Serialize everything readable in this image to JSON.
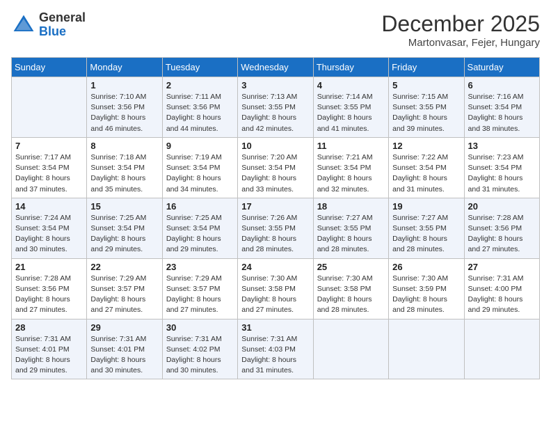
{
  "header": {
    "logo_line1": "General",
    "logo_line2": "Blue",
    "month": "December 2025",
    "location": "Martonvasar, Fejer, Hungary"
  },
  "weekdays": [
    "Sunday",
    "Monday",
    "Tuesday",
    "Wednesday",
    "Thursday",
    "Friday",
    "Saturday"
  ],
  "weeks": [
    [
      {
        "day": "",
        "sunrise": "",
        "sunset": "",
        "daylight": ""
      },
      {
        "day": "1",
        "sunrise": "Sunrise: 7:10 AM",
        "sunset": "Sunset: 3:56 PM",
        "daylight": "Daylight: 8 hours and 46 minutes."
      },
      {
        "day": "2",
        "sunrise": "Sunrise: 7:11 AM",
        "sunset": "Sunset: 3:56 PM",
        "daylight": "Daylight: 8 hours and 44 minutes."
      },
      {
        "day": "3",
        "sunrise": "Sunrise: 7:13 AM",
        "sunset": "Sunset: 3:55 PM",
        "daylight": "Daylight: 8 hours and 42 minutes."
      },
      {
        "day": "4",
        "sunrise": "Sunrise: 7:14 AM",
        "sunset": "Sunset: 3:55 PM",
        "daylight": "Daylight: 8 hours and 41 minutes."
      },
      {
        "day": "5",
        "sunrise": "Sunrise: 7:15 AM",
        "sunset": "Sunset: 3:55 PM",
        "daylight": "Daylight: 8 hours and 39 minutes."
      },
      {
        "day": "6",
        "sunrise": "Sunrise: 7:16 AM",
        "sunset": "Sunset: 3:54 PM",
        "daylight": "Daylight: 8 hours and 38 minutes."
      }
    ],
    [
      {
        "day": "7",
        "sunrise": "Sunrise: 7:17 AM",
        "sunset": "Sunset: 3:54 PM",
        "daylight": "Daylight: 8 hours and 37 minutes."
      },
      {
        "day": "8",
        "sunrise": "Sunrise: 7:18 AM",
        "sunset": "Sunset: 3:54 PM",
        "daylight": "Daylight: 8 hours and 35 minutes."
      },
      {
        "day": "9",
        "sunrise": "Sunrise: 7:19 AM",
        "sunset": "Sunset: 3:54 PM",
        "daylight": "Daylight: 8 hours and 34 minutes."
      },
      {
        "day": "10",
        "sunrise": "Sunrise: 7:20 AM",
        "sunset": "Sunset: 3:54 PM",
        "daylight": "Daylight: 8 hours and 33 minutes."
      },
      {
        "day": "11",
        "sunrise": "Sunrise: 7:21 AM",
        "sunset": "Sunset: 3:54 PM",
        "daylight": "Daylight: 8 hours and 32 minutes."
      },
      {
        "day": "12",
        "sunrise": "Sunrise: 7:22 AM",
        "sunset": "Sunset: 3:54 PM",
        "daylight": "Daylight: 8 hours and 31 minutes."
      },
      {
        "day": "13",
        "sunrise": "Sunrise: 7:23 AM",
        "sunset": "Sunset: 3:54 PM",
        "daylight": "Daylight: 8 hours and 31 minutes."
      }
    ],
    [
      {
        "day": "14",
        "sunrise": "Sunrise: 7:24 AM",
        "sunset": "Sunset: 3:54 PM",
        "daylight": "Daylight: 8 hours and 30 minutes."
      },
      {
        "day": "15",
        "sunrise": "Sunrise: 7:25 AM",
        "sunset": "Sunset: 3:54 PM",
        "daylight": "Daylight: 8 hours and 29 minutes."
      },
      {
        "day": "16",
        "sunrise": "Sunrise: 7:25 AM",
        "sunset": "Sunset: 3:54 PM",
        "daylight": "Daylight: 8 hours and 29 minutes."
      },
      {
        "day": "17",
        "sunrise": "Sunrise: 7:26 AM",
        "sunset": "Sunset: 3:55 PM",
        "daylight": "Daylight: 8 hours and 28 minutes."
      },
      {
        "day": "18",
        "sunrise": "Sunrise: 7:27 AM",
        "sunset": "Sunset: 3:55 PM",
        "daylight": "Daylight: 8 hours and 28 minutes."
      },
      {
        "day": "19",
        "sunrise": "Sunrise: 7:27 AM",
        "sunset": "Sunset: 3:55 PM",
        "daylight": "Daylight: 8 hours and 28 minutes."
      },
      {
        "day": "20",
        "sunrise": "Sunrise: 7:28 AM",
        "sunset": "Sunset: 3:56 PM",
        "daylight": "Daylight: 8 hours and 27 minutes."
      }
    ],
    [
      {
        "day": "21",
        "sunrise": "Sunrise: 7:28 AM",
        "sunset": "Sunset: 3:56 PM",
        "daylight": "Daylight: 8 hours and 27 minutes."
      },
      {
        "day": "22",
        "sunrise": "Sunrise: 7:29 AM",
        "sunset": "Sunset: 3:57 PM",
        "daylight": "Daylight: 8 hours and 27 minutes."
      },
      {
        "day": "23",
        "sunrise": "Sunrise: 7:29 AM",
        "sunset": "Sunset: 3:57 PM",
        "daylight": "Daylight: 8 hours and 27 minutes."
      },
      {
        "day": "24",
        "sunrise": "Sunrise: 7:30 AM",
        "sunset": "Sunset: 3:58 PM",
        "daylight": "Daylight: 8 hours and 27 minutes."
      },
      {
        "day": "25",
        "sunrise": "Sunrise: 7:30 AM",
        "sunset": "Sunset: 3:58 PM",
        "daylight": "Daylight: 8 hours and 28 minutes."
      },
      {
        "day": "26",
        "sunrise": "Sunrise: 7:30 AM",
        "sunset": "Sunset: 3:59 PM",
        "daylight": "Daylight: 8 hours and 28 minutes."
      },
      {
        "day": "27",
        "sunrise": "Sunrise: 7:31 AM",
        "sunset": "Sunset: 4:00 PM",
        "daylight": "Daylight: 8 hours and 29 minutes."
      }
    ],
    [
      {
        "day": "28",
        "sunrise": "Sunrise: 7:31 AM",
        "sunset": "Sunset: 4:01 PM",
        "daylight": "Daylight: 8 hours and 29 minutes."
      },
      {
        "day": "29",
        "sunrise": "Sunrise: 7:31 AM",
        "sunset": "Sunset: 4:01 PM",
        "daylight": "Daylight: 8 hours and 30 minutes."
      },
      {
        "day": "30",
        "sunrise": "Sunrise: 7:31 AM",
        "sunset": "Sunset: 4:02 PM",
        "daylight": "Daylight: 8 hours and 30 minutes."
      },
      {
        "day": "31",
        "sunrise": "Sunrise: 7:31 AM",
        "sunset": "Sunset: 4:03 PM",
        "daylight": "Daylight: 8 hours and 31 minutes."
      },
      {
        "day": "",
        "sunrise": "",
        "sunset": "",
        "daylight": ""
      },
      {
        "day": "",
        "sunrise": "",
        "sunset": "",
        "daylight": ""
      },
      {
        "day": "",
        "sunrise": "",
        "sunset": "",
        "daylight": ""
      }
    ]
  ]
}
